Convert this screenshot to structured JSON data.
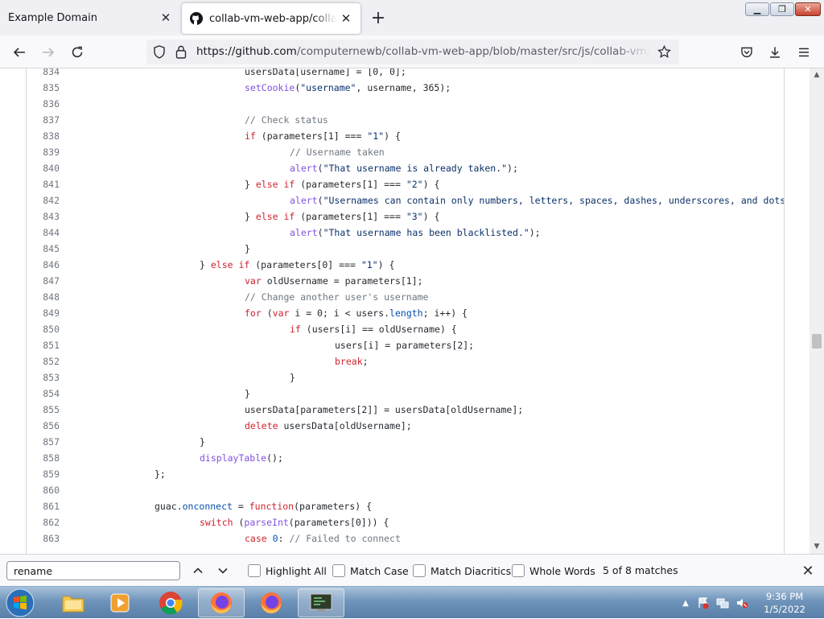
{
  "browser": {
    "tabs": [
      {
        "title": "Example Domain",
        "active": false
      },
      {
        "title": "collab-vm-web-app/collab-vm",
        "active": true
      }
    ],
    "new_tab_label": "+",
    "url_host": "https://github.com",
    "url_path": "/computernewb/collab-vm-web-app/blob/master/src/js/collab-vm/collab-vm"
  },
  "code": {
    "lines": [
      {
        "n": "834",
        "indent": 4,
        "t": [
          [
            "p",
            "usersData[username] = [0, 0];"
          ]
        ]
      },
      {
        "n": "835",
        "indent": 4,
        "t": [
          [
            "f",
            "setCookie"
          ],
          [
            "p",
            "("
          ],
          [
            "s",
            "\"username\""
          ],
          [
            "p",
            ", username, 365);"
          ]
        ]
      },
      {
        "n": "836",
        "indent": 0,
        "t": []
      },
      {
        "n": "837",
        "indent": 4,
        "t": [
          [
            "c",
            "// Check status"
          ]
        ]
      },
      {
        "n": "838",
        "indent": 4,
        "t": [
          [
            "k",
            "if"
          ],
          [
            "p",
            " (parameters[1] === "
          ],
          [
            "s",
            "\"1\""
          ],
          [
            "p",
            ") {"
          ]
        ]
      },
      {
        "n": "839",
        "indent": 5,
        "t": [
          [
            "c",
            "// Username taken"
          ]
        ]
      },
      {
        "n": "840",
        "indent": 5,
        "t": [
          [
            "f",
            "alert"
          ],
          [
            "p",
            "("
          ],
          [
            "s",
            "\"That username is already taken.\""
          ],
          [
            "p",
            ");"
          ]
        ]
      },
      {
        "n": "841",
        "indent": 4,
        "t": [
          [
            "p",
            "} "
          ],
          [
            "k",
            "else if"
          ],
          [
            "p",
            " (parameters[1] === "
          ],
          [
            "s",
            "\"2\""
          ],
          [
            "p",
            ") {"
          ]
        ]
      },
      {
        "n": "842",
        "indent": 5,
        "t": [
          [
            "f",
            "alert"
          ],
          [
            "p",
            "("
          ],
          [
            "s",
            "\"Usernames can contain only numbers, letters, spaces, dashes, underscores, and dots, and"
          ]
        ]
      },
      {
        "n": "843",
        "indent": 4,
        "t": [
          [
            "p",
            "} "
          ],
          [
            "k",
            "else if"
          ],
          [
            "p",
            " (parameters[1] === "
          ],
          [
            "s",
            "\"3\""
          ],
          [
            "p",
            ") {"
          ]
        ]
      },
      {
        "n": "844",
        "indent": 5,
        "t": [
          [
            "f",
            "alert"
          ],
          [
            "p",
            "("
          ],
          [
            "s",
            "\"That username has been blacklisted.\""
          ],
          [
            "p",
            ");"
          ]
        ]
      },
      {
        "n": "845",
        "indent": 4,
        "t": [
          [
            "p",
            "}"
          ]
        ]
      },
      {
        "n": "846",
        "indent": 3,
        "t": [
          [
            "p",
            "} "
          ],
          [
            "k",
            "else if"
          ],
          [
            "p",
            " (parameters[0] === "
          ],
          [
            "s",
            "\"1\""
          ],
          [
            "p",
            ") {"
          ]
        ]
      },
      {
        "n": "847",
        "indent": 4,
        "t": [
          [
            "k",
            "var"
          ],
          [
            "p",
            " oldUsername = parameters[1];"
          ]
        ]
      },
      {
        "n": "848",
        "indent": 4,
        "t": [
          [
            "c",
            "// Change another user's username"
          ]
        ]
      },
      {
        "n": "849",
        "indent": 4,
        "t": [
          [
            "k",
            "for"
          ],
          [
            "p",
            " ("
          ],
          [
            "k",
            "var"
          ],
          [
            "p",
            " i = 0; i < users."
          ],
          [
            "n",
            "length"
          ],
          [
            "p",
            "; i++) {"
          ]
        ]
      },
      {
        "n": "850",
        "indent": 5,
        "t": [
          [
            "k",
            "if"
          ],
          [
            "p",
            " (users[i] == oldUsername) {"
          ]
        ]
      },
      {
        "n": "851",
        "indent": 6,
        "t": [
          [
            "p",
            "users[i] = parameters[2];"
          ]
        ]
      },
      {
        "n": "852",
        "indent": 6,
        "t": [
          [
            "k",
            "break"
          ],
          [
            "p",
            ";"
          ]
        ]
      },
      {
        "n": "853",
        "indent": 5,
        "t": [
          [
            "p",
            "}"
          ]
        ]
      },
      {
        "n": "854",
        "indent": 4,
        "t": [
          [
            "p",
            "}"
          ]
        ]
      },
      {
        "n": "855",
        "indent": 4,
        "t": [
          [
            "p",
            "usersData[parameters[2]] = usersData[oldUsername];"
          ]
        ]
      },
      {
        "n": "856",
        "indent": 4,
        "t": [
          [
            "k",
            "delete"
          ],
          [
            "p",
            " usersData[oldUsername];"
          ]
        ]
      },
      {
        "n": "857",
        "indent": 3,
        "t": [
          [
            "p",
            "}"
          ]
        ]
      },
      {
        "n": "858",
        "indent": 3,
        "t": [
          [
            "f",
            "displayTable"
          ],
          [
            "p",
            "();"
          ]
        ]
      },
      {
        "n": "859",
        "indent": 2,
        "t": [
          [
            "p",
            "};"
          ]
        ]
      },
      {
        "n": "860",
        "indent": 0,
        "t": []
      },
      {
        "n": "861",
        "indent": 2,
        "t": [
          [
            "p",
            "guac."
          ],
          [
            "n",
            "onconnect"
          ],
          [
            "p",
            " = "
          ],
          [
            "k",
            "function"
          ],
          [
            "p",
            "(parameters) {"
          ]
        ]
      },
      {
        "n": "862",
        "indent": 3,
        "t": [
          [
            "k",
            "switch"
          ],
          [
            "p",
            " ("
          ],
          [
            "f",
            "parseInt"
          ],
          [
            "p",
            "(parameters[0])) {"
          ]
        ]
      },
      {
        "n": "863",
        "indent": 4,
        "t": [
          [
            "k",
            "case"
          ],
          [
            "p",
            " "
          ],
          [
            "n",
            "0"
          ],
          [
            "p",
            ": "
          ],
          [
            "c",
            "// Failed to connect"
          ]
        ]
      }
    ]
  },
  "findbar": {
    "value": "rename",
    "options": [
      {
        "label": "Highlight All",
        "checked": false
      },
      {
        "label": "Match Case",
        "checked": false
      },
      {
        "label": "Match Diacritics",
        "checked": false
      },
      {
        "label": "Whole Words",
        "checked": false
      }
    ],
    "status": "5 of 8 matches"
  },
  "taskbar": {
    "time": "9:36 PM",
    "date": "1/5/2022"
  },
  "colors": {
    "keyword": "#cf222e",
    "string": "#0a3069",
    "comment": "#6e7781",
    "function": "#8250df",
    "constant": "#0550ae"
  }
}
